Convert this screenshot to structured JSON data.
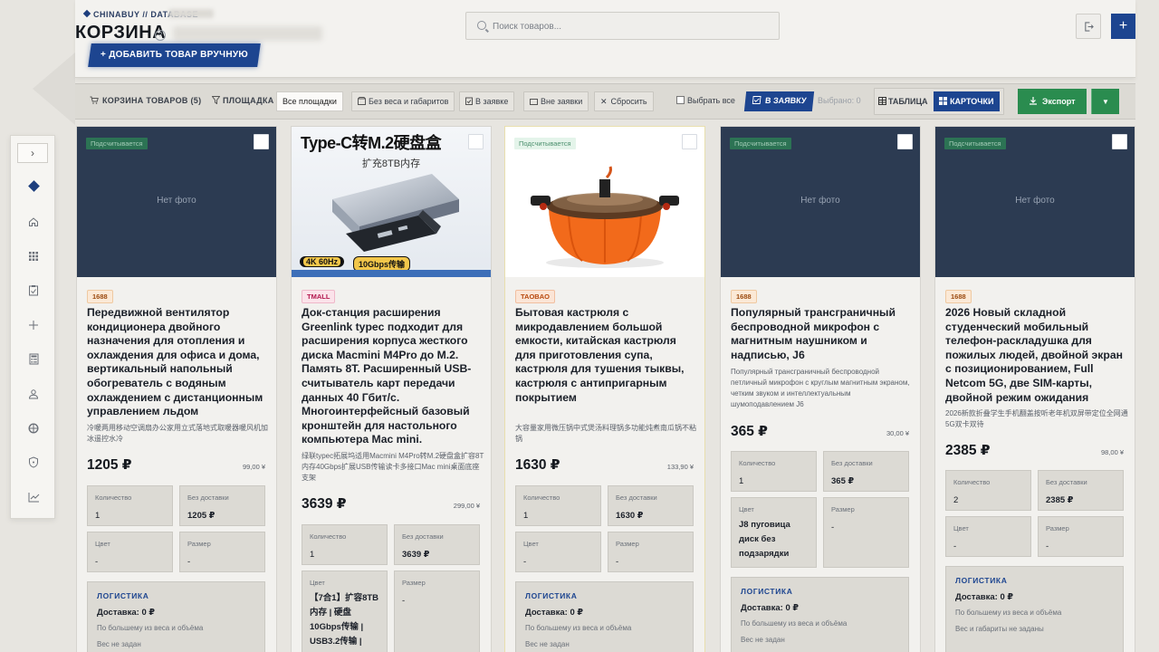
{
  "header": {
    "brand": "CHINABUY // DATABASE",
    "title": "КОРЗИНА",
    "help": "?",
    "add_manual": "+ ДОБАВИТЬ ТОВАР ВРУЧНУЮ",
    "search_placeholder": "Поиск товаров...",
    "plus": "+"
  },
  "toolbar": {
    "cart_label": "КОРЗИНА ТОВАРОВ (5)",
    "platform_label": "ПЛОЩАДКА",
    "platform_value": "Все площадки",
    "no_weight": "Без веса и габаритов",
    "in_request": "В заявке",
    "not_in_request": "Вне заявки",
    "reset": "Сбросить",
    "select_all": "Выбрать все",
    "to_request": "В ЗАЯВКУ",
    "selected": "Выбрано: 0",
    "table_view": "ТАБЛИЦА",
    "cards_view": "КАРТОЧКИ",
    "export": "Экспорт"
  },
  "sidebar": {
    "toggle": "›",
    "items": [
      "diamond-icon",
      "home-icon",
      "grid-icon",
      "clipboard-check-icon",
      "plus-icon",
      "calculator-icon",
      "user-icon",
      "globe-icon",
      "shield-icon",
      "chart-icon"
    ]
  },
  "labels": {
    "qty": "Количество",
    "no_delivery": "Без доставки",
    "color": "Цвет",
    "size": "Размер",
    "no_photo": "Нет фото",
    "calculating": "Подсчитывается",
    "logistics": "ЛОГИСТИКА",
    "by_max": "По большему из веса и объёма",
    "weight_missing": "Вес не задан",
    "weight_dims_missing": "Вес и габариты не заданы"
  },
  "products": [
    {
      "source": "1688",
      "title": "Передвижной вентилятор кондиционера двойного назначения для отопления и охлаждения для офиса и дома, вертикальный напольный обогреватель с водяным охлаждением с дистанционным управлением льдом",
      "desc": "冷暖两用移动空调扇办公家用立式落地式取暖器暖风机加冰遥控水冷",
      "price": "1205 ₽",
      "cny": "99,00 ¥",
      "qty": "1",
      "no_delivery": "1205 ₽",
      "color": "-",
      "size": "-",
      "delivery": "Доставка: 0 ₽"
    },
    {
      "source": "TMALL",
      "title": "Док-станция расширения Greenlink typec подходит для расширения корпуса жесткого диска Macmini M4Pro до M.2. Память 8Т. Расширенный USB-считыватель карт передачи данных 40 Гбит/с. Многоинтерфейсный базовый кронштейн для настольного компьютера Mac mini.",
      "desc": "绿联typec拓展坞适用Macmini M4Pro转M.2硬盘盒扩容8T内存40Gbps扩展USB传输读卡多接口Mac mini桌面底座支架",
      "price": "3639 ₽",
      "cny": "299,00 ¥",
      "qty": "1",
      "no_delivery": "3639 ₽",
      "color": "【7合1】扩容8TB内存 | 硬盘10Gbps传输 | USB3.2传输 |",
      "size": "-",
      "img_text_1": "Type-C转M.2硬盘盒",
      "img_text_2": "扩充8TB内存",
      "img_text_3": "4K 60Hz",
      "img_text_4": "10Gbps传输"
    },
    {
      "source": "TAOBAO",
      "title": "Бытовая кастрюля с микродавлением большой емкости, китайская кастрюля для приготовления супа, кастрюля для тушения тыквы, кастрюля с антипригарным покрытием",
      "desc": "大容量家用微压锅中式煲汤料理锅多功能炖煮南瓜锅不粘锅",
      "price": "1630 ₽",
      "cny": "133,90 ¥",
      "qty": "1",
      "no_delivery": "1630 ₽",
      "color": "-",
      "size": "-",
      "delivery": "Доставка: 0 ₽"
    },
    {
      "source": "1688",
      "title": "Популярный трансграничный беспроводной микрофон с магнитным наушником и надписью, J6",
      "desc": "Популярный трансграничный беспроводной петличный микрофон с круглым магнитным экраном, четким звуком и интеллектуальным шумоподавлением J6",
      "price": "365 ₽",
      "cny": "30,00 ¥",
      "qty": "1",
      "no_delivery": "365 ₽",
      "color": "J8 пуговица диск без подзарядки",
      "size": "-",
      "delivery": "Доставка: 0 ₽"
    },
    {
      "source": "1688",
      "title": "2026 Новый складной студенческий мобильный телефон-раскладушка для пожилых людей, двойной экран с позиционированием, Full Netcom 5G, две SIM-карты, двойной режим ожидания",
      "desc": "2026新款折叠学生手机翻盖按听老年机双屏带定位全网通5G双卡双待",
      "price": "2385 ₽",
      "cny": "98,00 ¥",
      "qty": "2",
      "no_delivery": "2385 ₽",
      "color": "-",
      "size": "-",
      "delivery": "Доставка: 0 ₽"
    }
  ]
}
